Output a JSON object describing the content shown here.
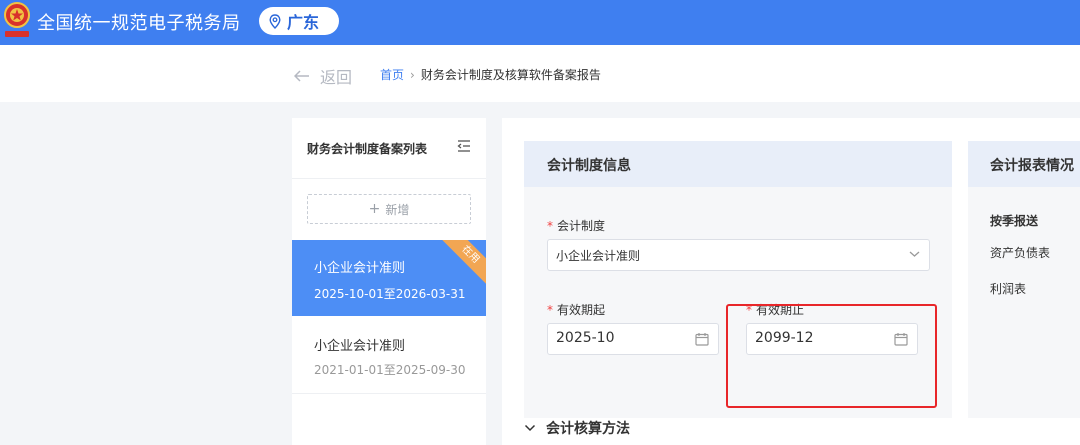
{
  "header": {
    "app_title": "全国统一规范电子税务局",
    "region": "广东",
    "brand_color": "#3f7ff0"
  },
  "subnav": {
    "back_label": "返回",
    "breadcrumb_home": "首页",
    "breadcrumb_separator": "›",
    "breadcrumb_current": "财务会计制度及核算软件备案报告"
  },
  "list_panel": {
    "title": "财务会计制度备案列表",
    "add_label": "新增",
    "items": [
      {
        "name": "小企业会计准则",
        "period": "2025-10-01至2026-03-31",
        "badge": "在用",
        "active": true
      },
      {
        "name": "小企业会计准则",
        "period": "2021-01-01至2025-09-30",
        "active": false
      }
    ]
  },
  "accounting_info": {
    "title": "会计制度信息",
    "system_label": "会计制度",
    "system_value": "小企业会计准则",
    "start_label": "有效期起",
    "start_value": "2025-10",
    "end_label": "有效期止",
    "end_value": "2099-12",
    "required_mark": "*"
  },
  "report_info": {
    "title": "会计报表情况",
    "frequency": "按季报送",
    "items": [
      "资产负债表",
      "利润表"
    ]
  },
  "method_section": {
    "title": "会计核算方法"
  },
  "colors": {
    "highlight_box": "#e8262a",
    "badge": "#f2a653",
    "active_card": "#4d8ef5"
  }
}
